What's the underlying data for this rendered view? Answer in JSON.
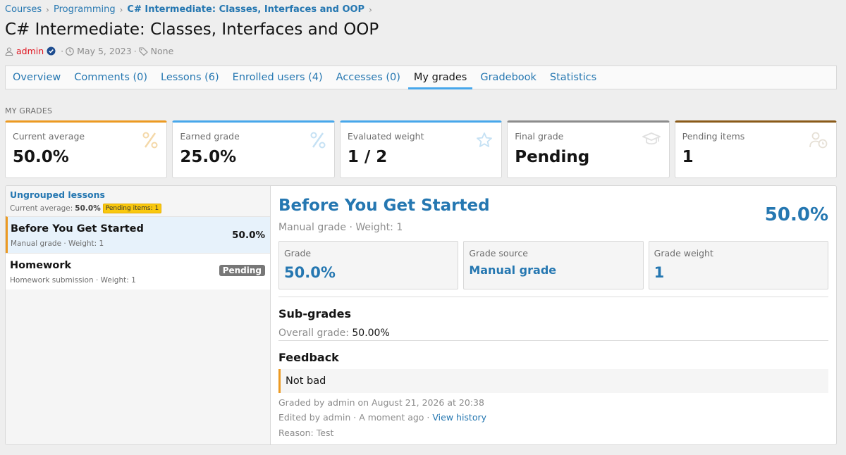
{
  "breadcrumb": [
    "Courses",
    "Programming",
    "C# Intermediate: Classes, Interfaces and OOP"
  ],
  "page_title": "C# Intermediate: Classes, Interfaces and OOP",
  "meta": {
    "author": "admin",
    "date": "May 5, 2023",
    "tags": "None",
    "icons": [
      "user-icon",
      "verified-icon",
      "clock-icon",
      "tag-icon"
    ],
    "author_color": "#e0131f"
  },
  "tabs": [
    {
      "label": "Overview",
      "active": false
    },
    {
      "label": "Comments (0)",
      "active": false
    },
    {
      "label": "Lessons (6)",
      "active": false
    },
    {
      "label": "Enrolled users (4)",
      "active": false
    },
    {
      "label": "Accesses (0)",
      "active": false
    },
    {
      "label": "My grades",
      "active": true
    },
    {
      "label": "Gradebook",
      "active": false
    },
    {
      "label": "Statistics",
      "active": false
    }
  ],
  "section_label": "MY GRADES",
  "cards": [
    {
      "label": "Current average",
      "value": "50.0%",
      "icon": "percent-icon",
      "accent": "#ec9a22"
    },
    {
      "label": "Earned grade",
      "value": "25.0%",
      "icon": "percent-icon",
      "accent": "#47a7eb"
    },
    {
      "label": "Evaluated weight",
      "value": "1 / 2",
      "icon": "star-icon",
      "accent": "#47a7eb"
    },
    {
      "label": "Final grade",
      "value": "Pending",
      "icon": "graduation-cap-icon",
      "accent": "#8c8c8c"
    },
    {
      "label": "Pending items",
      "value": "1",
      "icon": "user-clock-icon",
      "accent": "#8a5a19"
    }
  ],
  "group": {
    "title": "Ungrouped lessons",
    "avg_label": "Current average:",
    "avg_value": "50.0%",
    "pending_badge": "Pending items: 1"
  },
  "lessons": [
    {
      "title": "Before You Get Started",
      "sub": "Manual grade · Weight: 1",
      "value": "50.0%",
      "selected": true
    },
    {
      "title": "Homework",
      "sub": "Homework submission · Weight: 1",
      "badge": "Pending",
      "selected": false
    }
  ],
  "detail": {
    "title": "Before You Get Started",
    "value": "50.0%",
    "sub": "Manual grade · Weight: 1",
    "boxes": [
      {
        "label": "Grade",
        "value": "50.0%"
      },
      {
        "label": "Grade source",
        "value": "Manual grade"
      },
      {
        "label": "Grade weight",
        "value": "1"
      }
    ],
    "subgrades_heading": "Sub-grades",
    "overall_label": "Overall grade:",
    "overall_value": "50.00%",
    "feedback_heading": "Feedback",
    "feedback_text": "Not bad",
    "graded_by": "Graded by admin on August 21, 2026 at 20:38",
    "edited_by": "Edited by admin · A moment ago ·",
    "view_history": "View history",
    "reason": "Reason: Test"
  },
  "colors": {
    "link": "#2577b1",
    "active_tab_underline": "#47a7eb",
    "selected_marker": "#ec9a22",
    "pending_badge": "#777777",
    "pending_items_badge": "#f9c80e"
  }
}
